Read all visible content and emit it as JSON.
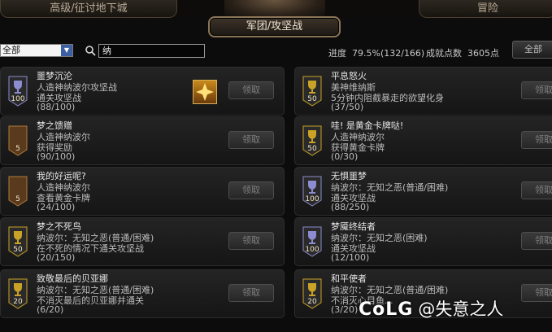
{
  "nav": {
    "left_tab": "高级/征讨地下城",
    "right_tab": "冒险",
    "active_category": "军团/攻坚战"
  },
  "filter": {
    "dropdown_value": "全部",
    "search_value": "纳",
    "progress_label": "进度",
    "progress_text": "79.5%(132/166)",
    "progress_fraction": 0.795,
    "points_label": "成就点数",
    "points_value": "3605点",
    "all_button": "全部"
  },
  "claim_label": "领取",
  "left_cards": [
    {
      "title": "噩梦沉沦",
      "lines": [
        "人造神纳波尔攻坚战",
        "通关攻坚战",
        "(88/100)"
      ],
      "badge": "100",
      "badge_tier": "silver",
      "has_reward": true
    },
    {
      "title": "梦之馈赠",
      "lines": [
        "人造神纳波尔",
        "获得奖励",
        "(90/100)"
      ],
      "badge": "5",
      "badge_tier": "bronze"
    },
    {
      "title": "我的好运呢?",
      "lines": [
        "人造神纳波尔",
        "查看黄金卡牌",
        "(24/100)"
      ],
      "badge": "5",
      "badge_tier": "bronze"
    },
    {
      "title": "梦之不死鸟",
      "lines": [
        "纳波尔：无知之恶(普通/困难)",
        "在不死的情况下通关攻坚战",
        "(20/150)"
      ],
      "badge": "50",
      "badge_tier": "gold"
    },
    {
      "title": "致敬最后的贝亚娜",
      "lines": [
        "纳波尔：无知之恶(普通/困难)",
        "不消灭最后的贝亚娜并通关",
        "(6/20)"
      ],
      "badge": "20",
      "badge_tier": "gold"
    }
  ],
  "right_cards": [
    {
      "title": "平息怒火",
      "lines": [
        "美神维纳斯",
        "5分钟内阻截暴走的欲望化身",
        "(37/50)"
      ],
      "badge": "50",
      "badge_tier": "gold"
    },
    {
      "title": "哇! 是黄金卡牌哒!",
      "lines": [
        "人造神纳波尔",
        "获得黄金卡牌",
        "(0/30)"
      ],
      "badge": "50",
      "badge_tier": "gold"
    },
    {
      "title": "无惧噩梦",
      "lines": [
        "纳波尔：无知之恶(普通/困难)",
        "通关攻坚战",
        "(88/250)"
      ],
      "badge": "100",
      "badge_tier": "silver"
    },
    {
      "title": "梦魇终结者",
      "lines": [
        "纳波尔：无知之恶(困难)",
        "通关攻坚战",
        "(12/100)"
      ],
      "badge": "100",
      "badge_tier": "silver"
    },
    {
      "title": "和平使者",
      "lines": [
        "纳波尔：无知之恶(普通/困难)",
        "不消灭心目鱼...",
        "(3/20)"
      ],
      "badge": "20",
      "badge_tier": "gold"
    }
  ],
  "watermark": {
    "logo": "CoLG",
    "handle": "@失意之人"
  },
  "colors": {
    "gold": "#c9a227",
    "silver": "#8c8cd0",
    "bronze": "#b07a3c"
  }
}
